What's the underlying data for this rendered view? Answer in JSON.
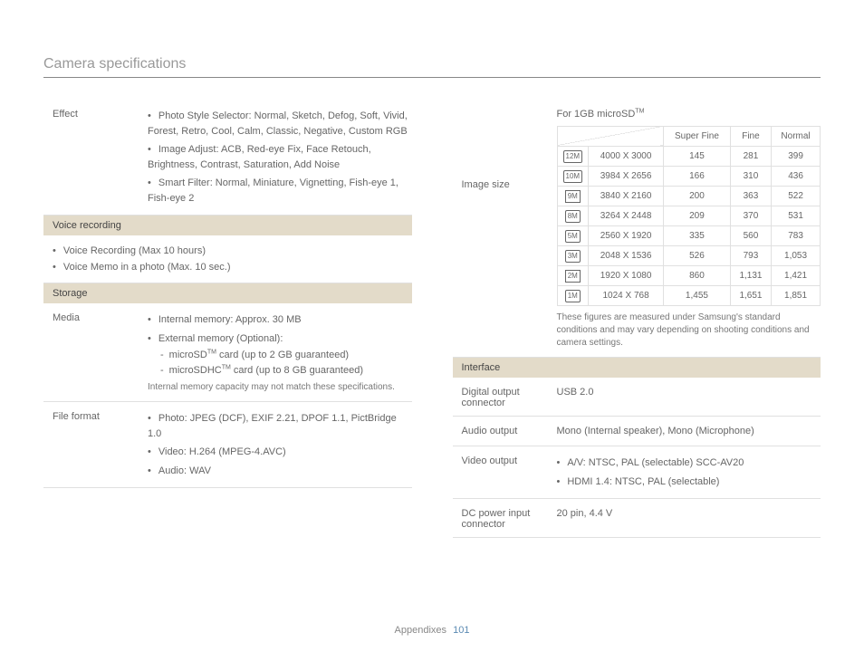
{
  "page": {
    "title": "Camera specifications",
    "footer_label": "Appendixes",
    "page_number": "101"
  },
  "effect": {
    "label": "Effect",
    "b1": "Photo Style Selector: Normal, Sketch, Defog, Soft, Vivid, Forest, Retro, Cool, Calm, Classic, Negative, Custom RGB",
    "b2": "Image Adjust: ACB, Red-eye Fix, Face Retouch, Brightness, Contrast, Saturation, Add Noise",
    "b3": "Smart Filter: Normal, Miniature, Vignetting, Fish-eye 1, Fish-eye 2"
  },
  "voice_recording": {
    "header": "Voice recording",
    "b1": "Voice Recording (Max 10 hours)",
    "b2": "Voice Memo in a photo (Max. 10 sec.)"
  },
  "storage": {
    "header": "Storage"
  },
  "media": {
    "label": "Media",
    "b1": "Internal memory: Approx. 30 MB",
    "b2": "External memory (Optional):",
    "d1a": "microSD",
    "d1b": " card (up to 2 GB guaranteed)",
    "d2a": "microSDHC",
    "d2b": " card (up to 8 GB guaranteed)",
    "note": "Internal memory capacity may not match these specifications.",
    "tm": "TM"
  },
  "fileformat": {
    "label": "File format",
    "b1": "Photo: JPEG (DCF), EXIF 2.21, DPOF 1.1, PictBridge 1.0",
    "b2": "Video: H.264 (MPEG-4.AVC)",
    "b3": "Audio: WAV"
  },
  "image_size": {
    "label": "Image size",
    "for_1gb_a": "For 1GB microSD",
    "tm": "TM",
    "headers": {
      "sf": "Super Fine",
      "f": "Fine",
      "n": "Normal"
    },
    "rows": [
      {
        "mp": "12M",
        "res": "4000 X 3000",
        "sf": "145",
        "f": "281",
        "n": "399"
      },
      {
        "mp": "10M",
        "res": "3984 X 2656",
        "sf": "166",
        "f": "310",
        "n": "436"
      },
      {
        "mp": "9M",
        "res": "3840 X 2160",
        "sf": "200",
        "f": "363",
        "n": "522"
      },
      {
        "mp": "8M",
        "res": "3264 X 2448",
        "sf": "209",
        "f": "370",
        "n": "531"
      },
      {
        "mp": "5M",
        "res": "2560 X 1920",
        "sf": "335",
        "f": "560",
        "n": "783"
      },
      {
        "mp": "3M",
        "res": "2048 X 1536",
        "sf": "526",
        "f": "793",
        "n": "1,053"
      },
      {
        "mp": "2M",
        "res": "1920 X 1080",
        "sf": "860",
        "f": "1,131",
        "n": "1,421"
      },
      {
        "mp": "1M",
        "res": "1024 X 768",
        "sf": "1,455",
        "f": "1,651",
        "n": "1,851"
      }
    ],
    "note": "These figures are measured under Samsung's standard conditions and may vary depending on shooting conditions and camera settings."
  },
  "interface": {
    "header": "Interface",
    "digital_output": {
      "label": "Digital output connector",
      "value": "USB 2.0"
    },
    "audio_output": {
      "label": "Audio output",
      "value": "Mono (Internal speaker), Mono (Microphone)"
    },
    "video_output": {
      "label": "Video output",
      "b1": "A/V: NTSC, PAL (selectable) SCC-AV20",
      "b2": "HDMI 1.4: NTSC, PAL (selectable)"
    },
    "dc_power": {
      "label": "DC power input connector",
      "value": "20 pin, 4.4 V"
    }
  }
}
